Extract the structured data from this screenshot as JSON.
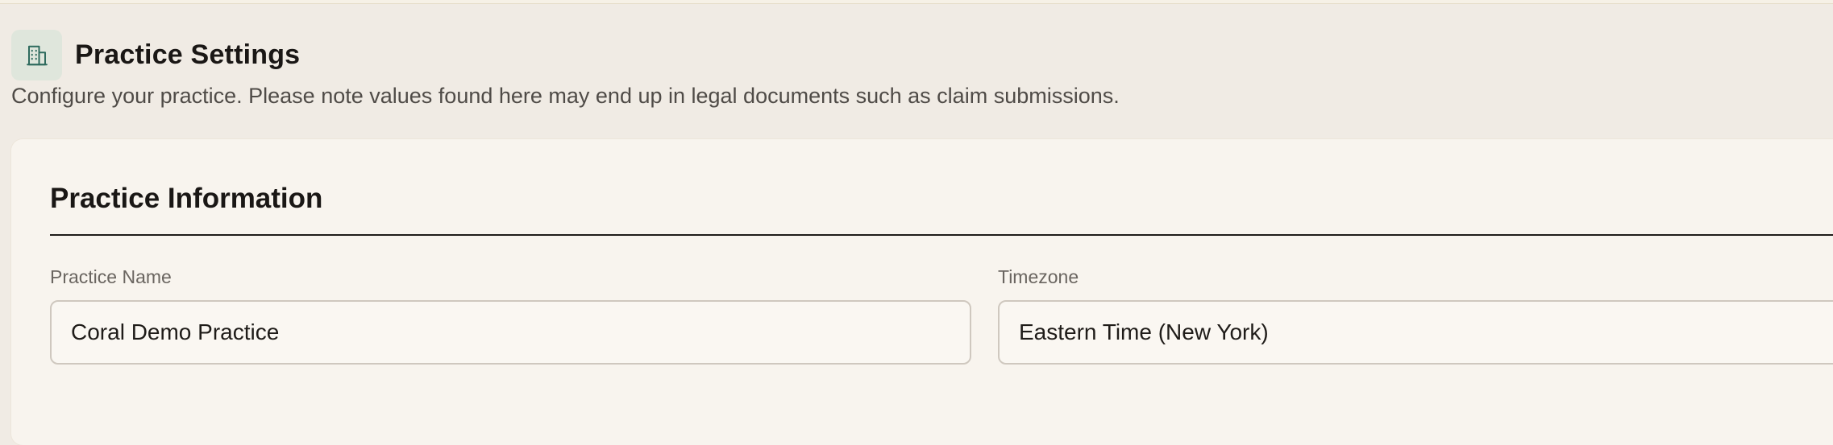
{
  "header": {
    "icon": "building-icon",
    "title": "Practice Settings",
    "subtitle": "Configure your practice. Please note values found here may end up in legal documents such as claim submissions."
  },
  "practice_information": {
    "section_title": "Practice Information",
    "practice_name": {
      "label": "Practice Name",
      "value": "Coral Demo Practice"
    },
    "timezone": {
      "label": "Timezone",
      "value": "Eastern Time (New York)"
    }
  },
  "colors": {
    "accent_icon": "#2f6b5e",
    "icon_background": "#dfe6dc",
    "page_background": "#f0ebe4",
    "card_background": "#f8f4ee"
  }
}
